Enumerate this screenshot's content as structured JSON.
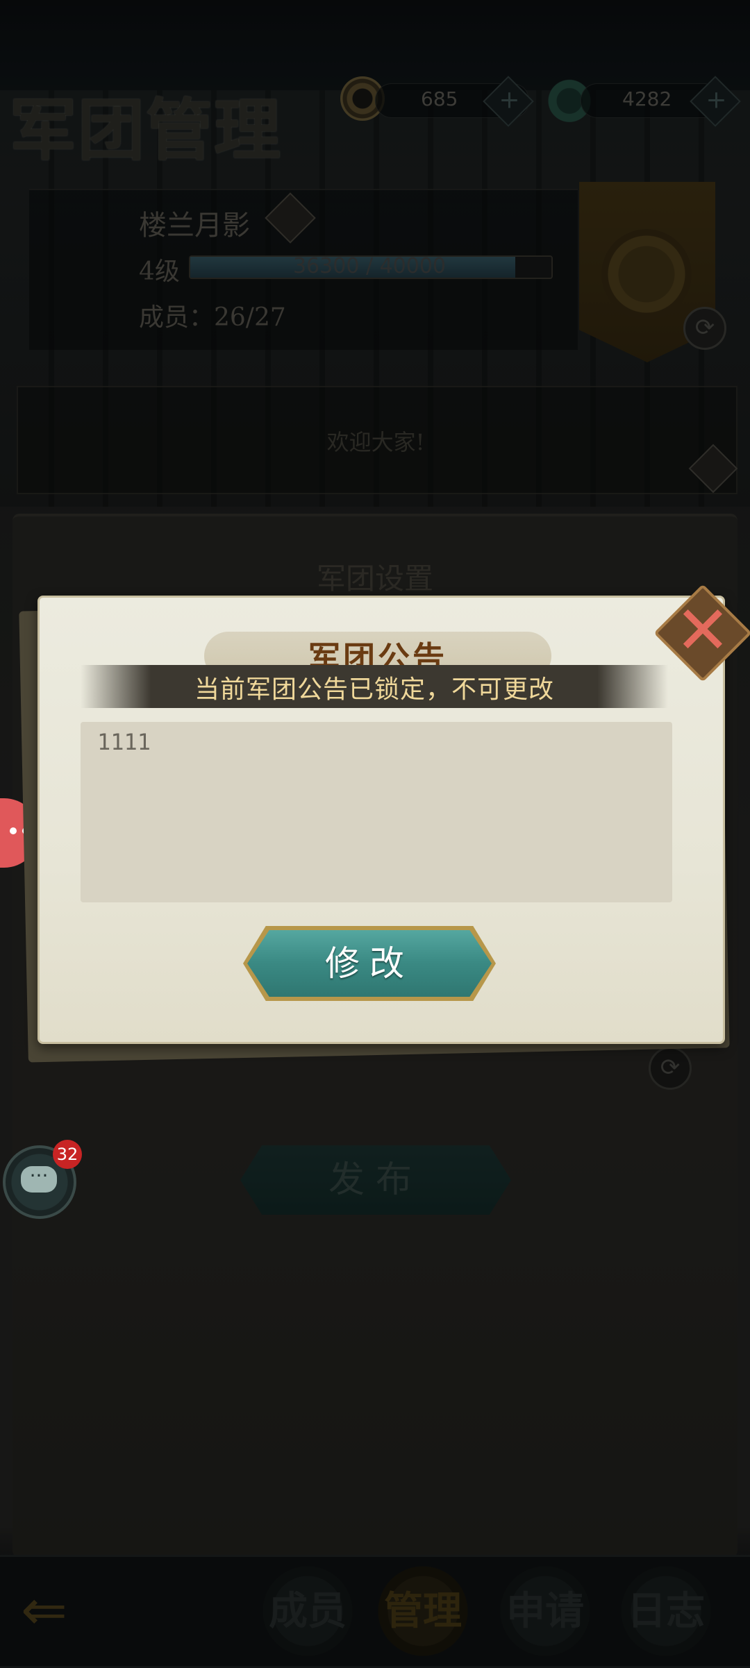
{
  "header": {
    "title": "军团管理",
    "coin_value": "685",
    "jade_value": "4282",
    "plus_symbol": "+"
  },
  "guild": {
    "name": "楼兰月影",
    "level": "4级",
    "xp_text": "36300 / 40000",
    "xp_fraction": 0.9075,
    "members": "成员：26/27",
    "welcome_notice": "欢迎大家!"
  },
  "settings": {
    "title": "军团设置",
    "publish_label": "发布"
  },
  "modal": {
    "title": "军团公告",
    "locked_message": "当前军团公告已锁定，不可更改",
    "notice_content": "1111",
    "modify_label": "修改",
    "close_symbol": "✕"
  },
  "chat": {
    "badge_count": "32",
    "icon": "···"
  },
  "nav": {
    "back_icon": "⇐",
    "tabs": [
      {
        "label": "成员"
      },
      {
        "label": "管理",
        "active": true
      },
      {
        "label": "申请"
      },
      {
        "label": "日志"
      }
    ]
  },
  "icons": {
    "refresh": "⟳"
  }
}
